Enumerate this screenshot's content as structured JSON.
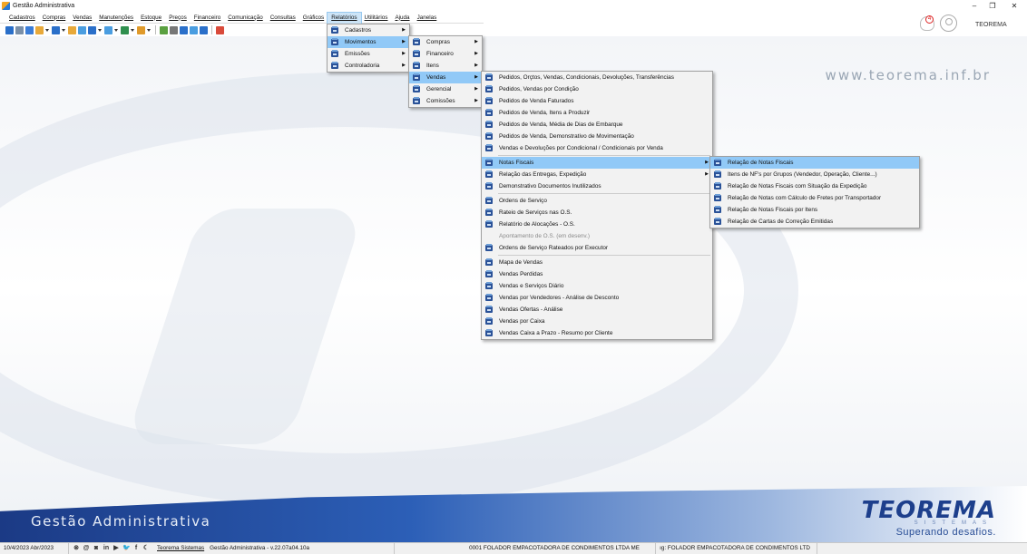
{
  "window": {
    "title": "Gestão Administrativa",
    "controls": {
      "minimize": "–",
      "restore": "❐",
      "close": "✕"
    }
  },
  "menubar": [
    "Cadastros",
    "Compras",
    "Vendas",
    "Manutenções",
    "Estoque",
    "Preços",
    "Financeiro",
    "Comunicação",
    "Consultas",
    "Gráficos",
    "Relatórios",
    "Utilitários",
    "Ajuda",
    "Janelas"
  ],
  "toolbar_colors": [
    "#2a6fc9",
    "#7a8fa8",
    "#3b7dd8",
    "#e8a93a",
    "#2a6fc9",
    "#e8a93a",
    "#4a9de0",
    "#2a6fc9",
    "#4a9de0",
    "#2f8f4e",
    "#e09a2a",
    "#5aa040",
    "#777777",
    "#2a6fc9",
    "#4a9de0",
    "#2a6fc9",
    "#d94a3a",
    "#f0b429",
    "#d65a2a",
    "#f2c94c"
  ],
  "header": {
    "company": "TEOREMA",
    "notification_count": "4"
  },
  "background": {
    "website": "www.teorema.inf.br",
    "app_name": "Gestão Administrativa",
    "logo": {
      "brand": "TEOREMA",
      "sub": "SISTEMAS",
      "tagline": "Superando desafios."
    }
  },
  "menus": {
    "relatorios": [
      "Cadastros",
      "Movimentos",
      "Emissões",
      "Controladoria"
    ],
    "movimentos": [
      "Compras",
      "Financeiro",
      "Itens",
      "Vendas",
      "Gerencial",
      "Comissões"
    ],
    "vendas": [
      "Pedidos, Orçtos, Vendas, Condicionais, Devoluções, Transferências",
      "Pedidos, Vendas por Condição",
      "Pedidos de Venda Faturados",
      "Pedidos de Venda, Itens a Produzir",
      "Pedidos de Venda, Média de Dias de Embarque",
      "Pedidos de Venda, Demonstrativo de Movimentação",
      "Vendas e Devoluções por Condicional / Condicionais por Venda",
      "Notas Fiscais",
      "Relação das Entregas, Expedição",
      "Demonstrativo Documentos Inutilizados",
      "Ordens de Serviço",
      "Rateio de Serviços nas O.S.",
      "Relatório de Alocações - O.S.",
      "Apontamento de O.S. (em desenv.)",
      "Ordens de Serviço Rateados por Executor",
      "Mapa de Vendas",
      "Vendas Perdidas",
      "Vendas e Serviços Diário",
      "Vendas por Vendedores - Análise de Desconto",
      "Vendas Ofertas - Análise",
      "Vendas por Caixa",
      "Vendas Caixa a Prazo - Resumo por Cliente"
    ],
    "notas_fiscais": [
      "Relação de Notas Fiscais",
      "Itens de NF's por Grupos (Vendedor, Operação, Cliente...)",
      "Relação de Notas Fiscais com Situação da Expedição",
      "Relação de Notas com Cálculo de Fretes por Transportador",
      "Relação de Notas Fiscais por Itens",
      "Relação de Cartas de Correção Emitidas"
    ]
  },
  "statusbar": {
    "date": "10/4/2023 Abr/2023",
    "social_icons": [
      "⊗",
      "@",
      "◙",
      "in",
      "▶",
      "🐦",
      "f",
      "☾"
    ],
    "link": "Teorema Sistemas",
    "version": "Gestão Administrativa - v.22.07a04.10a",
    "company": "0001 FOLADOR EMPACOTADORA DE CONDIMENTOS LTDA ME",
    "company2": "ıg: FOLADOR EMPACOTADORA DE CONDIMENTOS LTD"
  }
}
